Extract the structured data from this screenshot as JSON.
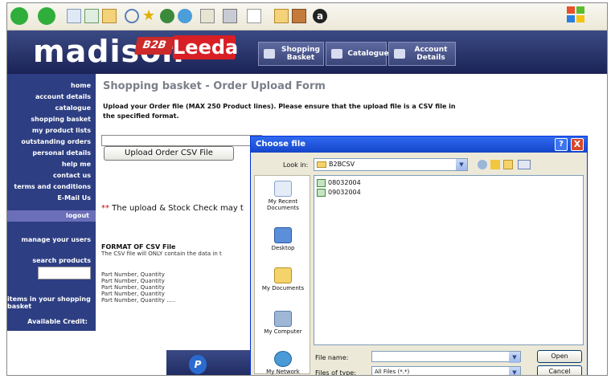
{
  "browser": {
    "toolbar_icons": [
      "back-icon",
      "forward-icon",
      "stop-icon",
      "refresh-icon",
      "home-icon",
      "search-icon",
      "favorites-icon",
      "media-icon",
      "history-icon",
      "mail-icon",
      "print-icon",
      "edit-icon",
      "discuss-icon",
      "folder-icon",
      "messenger-icon",
      "at-icon"
    ]
  },
  "header": {
    "logo_text": "madison",
    "b2b": "B2B",
    "leeda": "Leeda",
    "tabs": [
      {
        "label": "Shopping Basket",
        "icon": "cart-icon"
      },
      {
        "label": "Catalogue",
        "icon": "catalogue-icon"
      },
      {
        "label": "Account Details",
        "icon": "account-icon"
      }
    ]
  },
  "sidebar": {
    "items": [
      "home",
      "account details",
      "catalogue",
      "shopping basket",
      "my product lists",
      "outstanding orders",
      "personal details",
      "help me",
      "contact us",
      "terms and conditions",
      "E-Mail Us"
    ],
    "logout": "logout",
    "manage_users": "manage your users",
    "search_products": "search products",
    "basket_count": "items in your shopping basket",
    "credit_label": "Available Credit:"
  },
  "content": {
    "title": "Shopping basket - Order Upload Form",
    "intro": "Upload your Order file (MAX 250 Product lines). Please ensure that the upload file is a CSV file in the specified format.",
    "upload_button": "Upload Order CSV File",
    "warning_stars": "**",
    "warning_text": " The upload & Stock Check may t",
    "format_title": "FORMAT OF CSV File",
    "format_text": "The CSV file will ONLY contain the data in t",
    "format_lines": [
      "Part Number, Quantity",
      "Part Number, Quantity",
      "Part Number, Quantity",
      "Part Number, Quantity",
      "Part Number, Quantity ....."
    ]
  },
  "dialog": {
    "title": "Choose file",
    "help": "?",
    "close": "X",
    "look_in_label": "Look in:",
    "look_in_value": "B2BCSV",
    "places": [
      "My Recent Documents",
      "Desktop",
      "My Documents",
      "My Computer",
      "My Network"
    ],
    "files": [
      "08032004",
      "09032004"
    ],
    "file_name_label": "File name:",
    "file_name_value": "",
    "files_of_type_label": "Files of type:",
    "files_of_type_value": "All Files (*.*)",
    "open_button": "Open",
    "cancel_button": "Cancel"
  }
}
